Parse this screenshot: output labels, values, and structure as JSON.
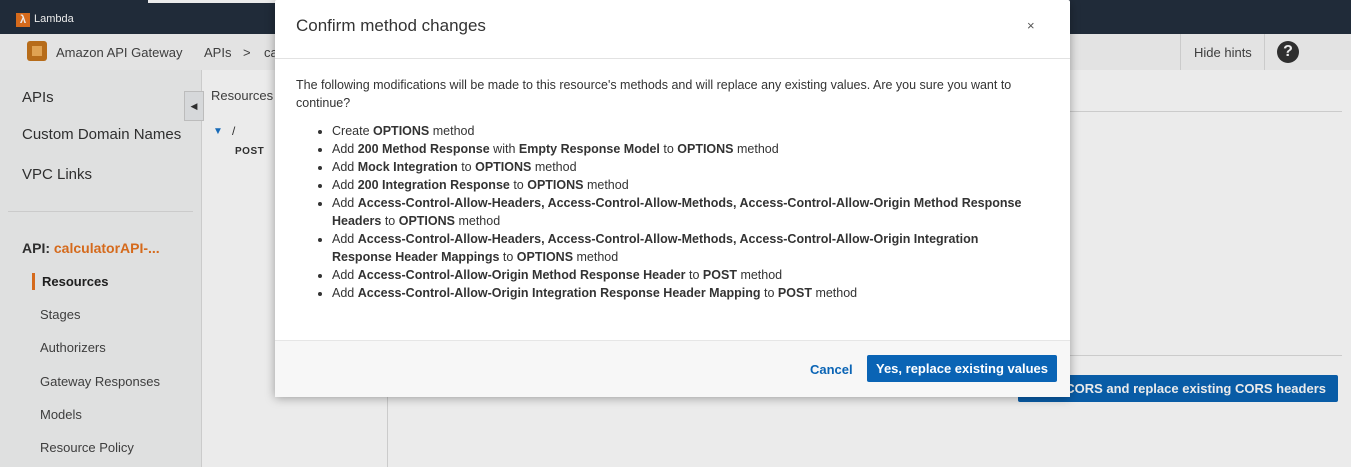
{
  "topbar": {
    "service_label": "Lambda"
  },
  "subheader": {
    "service_name": "Amazon API Gateway",
    "crumb_apis": "APIs",
    "crumb_sep": ">",
    "crumb_partial": "ca",
    "hide_hints": "Hide hints",
    "help": "?"
  },
  "sidebar": {
    "links": [
      "APIs",
      "Custom Domain Names",
      "VPC Links"
    ],
    "api_prefix": "API:",
    "api_name": "calculatorAPI-...",
    "sub_links": [
      "Resources",
      "Stages",
      "Authorizers",
      "Gateway Responses",
      "Models",
      "Resource Policy"
    ],
    "collapse": "◀"
  },
  "resources": {
    "title": "Resources",
    "root": "/",
    "method": "POST"
  },
  "main": {
    "enable_button_partial": "CORS and replace existing CORS headers"
  },
  "modal": {
    "title": "Confirm method changes",
    "close": "×",
    "intro": "The following modifications will be made to this resource's methods and will replace any existing values. Are you sure you want to continue?",
    "items": [
      [
        {
          "t": "Create "
        },
        {
          "b": "OPTIONS"
        },
        {
          "t": " method"
        }
      ],
      [
        {
          "t": "Add "
        },
        {
          "b": "200 Method Response"
        },
        {
          "t": " with "
        },
        {
          "b": "Empty Response Model"
        },
        {
          "t": " to "
        },
        {
          "b": "OPTIONS"
        },
        {
          "t": " method"
        }
      ],
      [
        {
          "t": "Add "
        },
        {
          "b": "Mock Integration"
        },
        {
          "t": " to "
        },
        {
          "b": "OPTIONS"
        },
        {
          "t": " method"
        }
      ],
      [
        {
          "t": "Add "
        },
        {
          "b": "200 Integration Response"
        },
        {
          "t": " to "
        },
        {
          "b": "OPTIONS"
        },
        {
          "t": " method"
        }
      ],
      [
        {
          "t": "Add "
        },
        {
          "b": "Access-Control-Allow-Headers, Access-Control-Allow-Methods, Access-Control-Allow-Origin Method Response Headers"
        },
        {
          "t": " to "
        },
        {
          "b": "OPTIONS"
        },
        {
          "t": " method"
        }
      ],
      [
        {
          "t": "Add "
        },
        {
          "b": "Access-Control-Allow-Headers, Access-Control-Allow-Methods, Access-Control-Allow-Origin Integration Response Header Mappings"
        },
        {
          "t": " to "
        },
        {
          "b": "OPTIONS"
        },
        {
          "t": " method"
        }
      ],
      [
        {
          "t": "Add "
        },
        {
          "b": "Access-Control-Allow-Origin Method Response Header"
        },
        {
          "t": " to "
        },
        {
          "b": "POST"
        },
        {
          "t": " method"
        }
      ],
      [
        {
          "t": "Add "
        },
        {
          "b": "Access-Control-Allow-Origin Integration Response Header Mapping"
        },
        {
          "t": " to "
        },
        {
          "b": "POST"
        },
        {
          "t": " method"
        }
      ]
    ],
    "cancel": "Cancel",
    "confirm": "Yes, replace existing values"
  }
}
